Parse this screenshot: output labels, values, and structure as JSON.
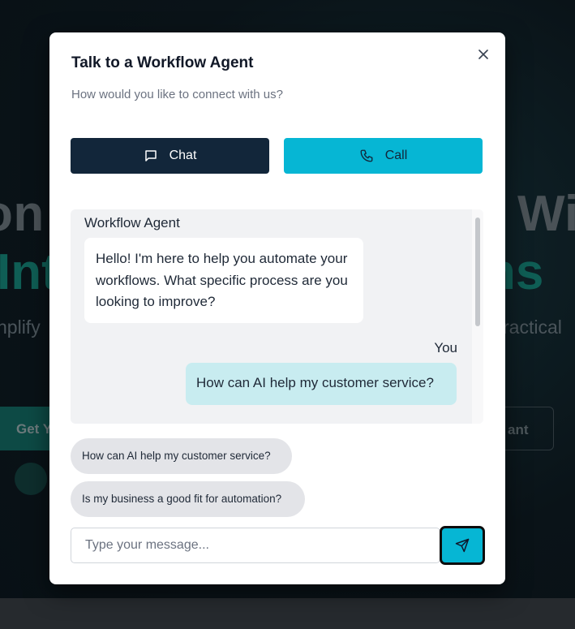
{
  "background": {
    "hero_line1_left": "on",
    "hero_line1_right": "Wi",
    "hero_line2_left": "Int",
    "hero_line2_right": "ns",
    "subtitle_left": "nplify",
    "subtitle_right": "ractical",
    "primary_button": "Get Y",
    "secondary_button": "ant"
  },
  "modal": {
    "title": "Talk to a Workflow Agent",
    "subtitle": "How would you like to connect with us?",
    "close_icon": "close-icon"
  },
  "tabs": {
    "chat_label": "Chat",
    "chat_icon": "message-square-icon",
    "call_label": "Call",
    "call_icon": "phone-icon"
  },
  "chat": {
    "messages": [
      {
        "sender": "Workflow Agent",
        "text": "Hello! I'm here to help you automate your workflows. What specific process are you looking to improve?"
      },
      {
        "sender": "You",
        "text": "How can AI help my customer service?"
      }
    ]
  },
  "suggestions": [
    "How can AI help my customer service?",
    "Is my business a good fit for automation?"
  ],
  "composer": {
    "placeholder": "Type your message...",
    "value": "",
    "send_icon": "send-icon"
  },
  "colors": {
    "chat_tab": "#12263a",
    "call_tab": "#06b6d4",
    "user_bubble": "#c8ecf0",
    "chat_background": "#f1f2f4"
  }
}
